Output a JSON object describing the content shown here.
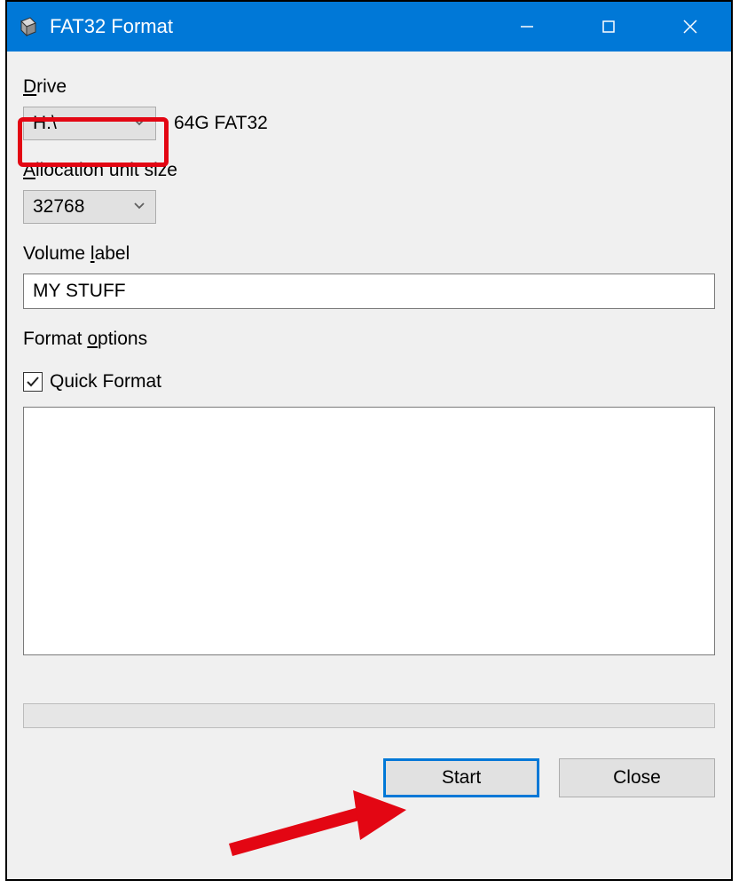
{
  "window": {
    "title": "FAT32 Format"
  },
  "labels": {
    "drive_pre": "D",
    "drive_post": "rive",
    "alloc_pre": "A",
    "alloc_post": "llocation unit size",
    "volume_pre": "Volume ",
    "volume_u": "l",
    "volume_post": "abel",
    "format_pre": "Format ",
    "format_u": "o",
    "format_post": "ptions",
    "quick_format": "Quick Format"
  },
  "drive": {
    "selected": "H:\\",
    "info": "64G FAT32"
  },
  "allocation": {
    "selected": "32768"
  },
  "volume_label": {
    "value": "MY STUFF"
  },
  "options": {
    "quick_format_checked": true
  },
  "buttons": {
    "start": "Start",
    "close": "Close"
  }
}
